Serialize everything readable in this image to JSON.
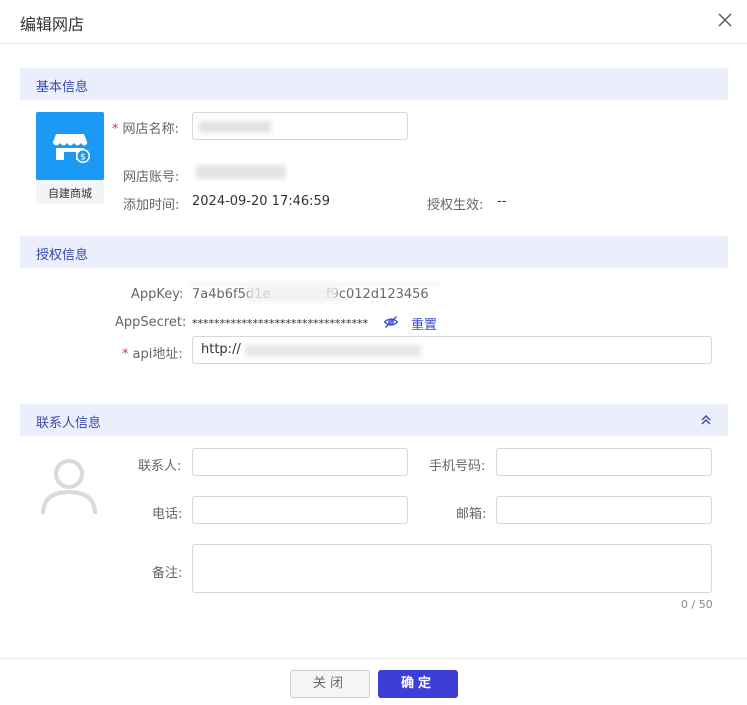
{
  "dialog": {
    "title": "编辑网店",
    "close_glyph": "╳"
  },
  "basic": {
    "section_title": "基本信息",
    "logo_label": "自建商城",
    "shop_name_label": "网店名称:",
    "shop_account_label": "网店账号:",
    "added_time_label": "添加时间:",
    "added_time_value": "2024-09-20 17:46:59",
    "auth_effective_label": "授权生效:",
    "auth_effective_value": "--"
  },
  "auth": {
    "section_title": "授权信息",
    "appkey_label": "AppKey:",
    "appkey_value": "7a4b6f5d1e",
    "appkey_tail": "f9c012d123456",
    "appsecret_label": "AppSecret:",
    "appsecret_value": "********************************",
    "reset_label": "重置",
    "api_label": "api地址:",
    "api_value": "http://"
  },
  "contact": {
    "section_title": "联系人信息",
    "contact_label": "联系人:",
    "mobile_label": "手机号码:",
    "phone_label": "电话:",
    "email_label": "邮箱:",
    "remark_label": "备注:",
    "remark_counter": "0 / 50"
  },
  "footer": {
    "cancel_label": "关闭",
    "ok_label": "确定"
  },
  "colors": {
    "accent": "#3b3fd8",
    "section_bg": "#ebeffc",
    "logo_blue": "#1a9af5",
    "required": "#e53935"
  },
  "icons": {
    "close": "close-icon",
    "shop": "store-icon",
    "eye": "eye-hidden-icon",
    "collapse": "double-chevron-up-icon",
    "avatar": "user-avatar-icon"
  }
}
